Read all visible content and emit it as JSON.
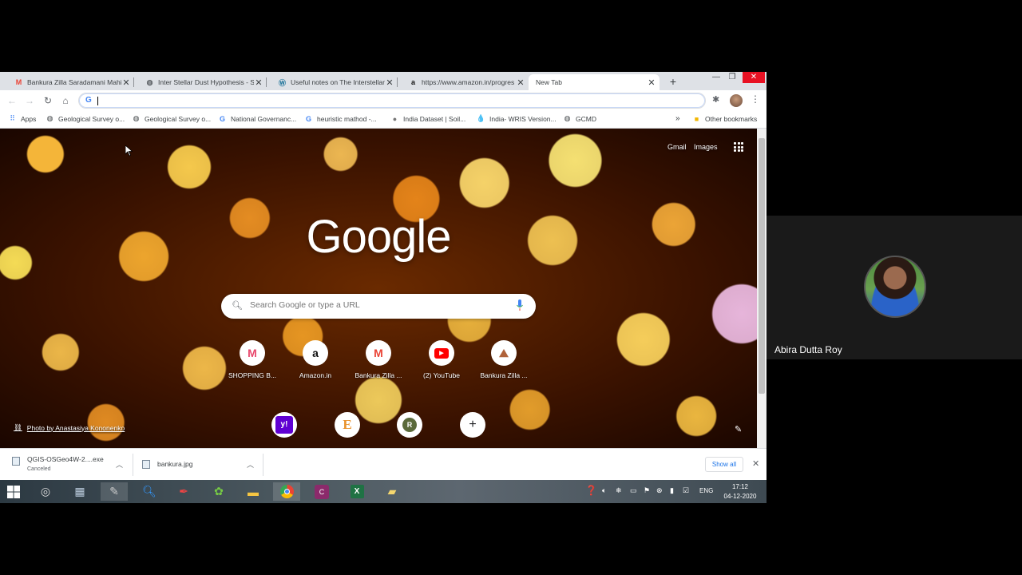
{
  "browser": {
    "tabs": [
      {
        "title": "Bankura Zilla Saradamani Mahil",
        "icon": "gmail-icon",
        "active": false
      },
      {
        "title": "Inter Stellar Dust Hypothesis - S",
        "icon": "globe-icon",
        "active": false
      },
      {
        "title": "Useful notes on The Interstellar",
        "icon": "wordpress-icon",
        "active": false
      },
      {
        "title": "https://www.amazon.in/progres",
        "icon": "amazon-icon",
        "active": false
      },
      {
        "title": "New Tab",
        "icon": "",
        "active": true
      }
    ],
    "new_tab_glyph": "+",
    "window_buttons": {
      "minimize": "—",
      "restore": "❐",
      "close": "✕"
    },
    "omnibox": {
      "value": "",
      "g_glyph": "G"
    },
    "bookmarks": [
      {
        "label": "Apps",
        "icon": "apps-grid-icon"
      },
      {
        "label": "Geological Survey o...",
        "icon": "globe-icon"
      },
      {
        "label": "Geological Survey o...",
        "icon": "globe-icon"
      },
      {
        "label": "National Governanc...",
        "icon": "google-icon"
      },
      {
        "label": "heuristic mathod -...",
        "icon": "google-icon"
      },
      {
        "label": "India Dataset | Soil...",
        "icon": "soil-icon"
      },
      {
        "label": "India- WRIS Version...",
        "icon": "water-drop-icon"
      },
      {
        "label": "GCMD",
        "icon": "globe-icon"
      }
    ],
    "bookmarks_overflow": "»",
    "other_bookmarks": "Other bookmarks"
  },
  "ntp": {
    "gmail": "Gmail",
    "images": "Images",
    "logo": "Google",
    "search_placeholder": "Search Google or type a URL",
    "shortcuts": [
      {
        "label": "SHOPPING B...",
        "glyph": "M",
        "color": "#e8466b"
      },
      {
        "label": "Amazon.in",
        "glyph": "a",
        "color": "#111111"
      },
      {
        "label": "Bankura Zilla ...",
        "glyph": "M",
        "color": "#ea4335"
      },
      {
        "label": "(2) YouTube",
        "glyph": "▶",
        "color": "#ff0000"
      },
      {
        "label": "Bankura Zilla ...",
        "glyph": "⛰",
        "color": "#b0623a"
      }
    ],
    "shortcuts_row2": [
      {
        "glyph": "y!",
        "bg": "#6001d2",
        "fg": "#ffffff"
      },
      {
        "glyph": "E",
        "bg": "#ffffff",
        "fg": "#e8912b"
      },
      {
        "glyph": "R",
        "bg": "#ffffff",
        "fg": "#ffffff"
      },
      {
        "glyph": "+",
        "bg": "#ffffff",
        "fg": "#202124"
      }
    ],
    "photo_credit": "Photo by Anastasiya Kononenko"
  },
  "downloads": {
    "items": [
      {
        "name": "QGIS-OSGeo4W-2....exe",
        "status": "Canceled"
      },
      {
        "name": "bankura.jpg",
        "status": ""
      }
    ],
    "show_all": "Show all"
  },
  "taskbar": {
    "lang": "ENG",
    "time": "17:12",
    "date": "04-12-2020"
  },
  "participant": {
    "name": "Abira Dutta Roy"
  }
}
